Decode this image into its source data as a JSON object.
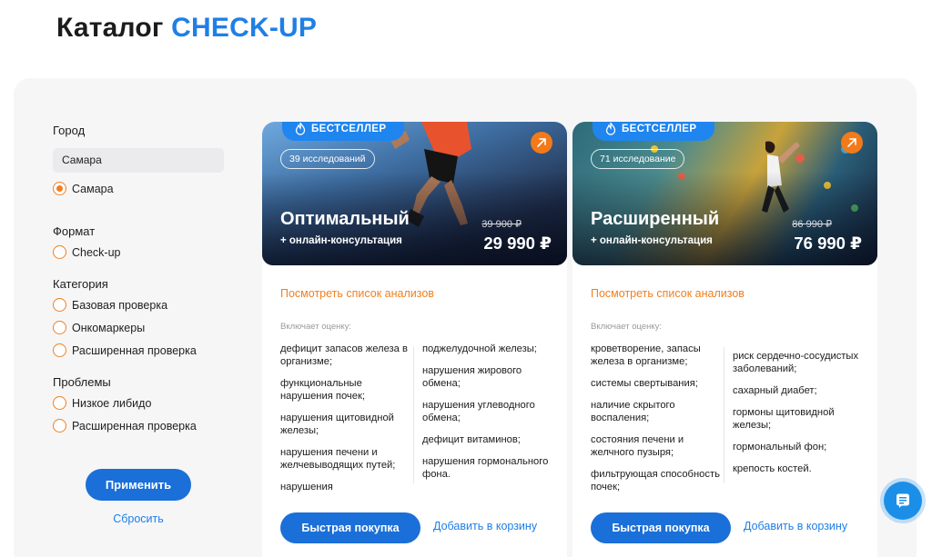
{
  "header": {
    "title_part1": "Каталог ",
    "title_part2": "CHECK-UP"
  },
  "filters": {
    "city": {
      "heading": "Город",
      "selected": "Самара",
      "options": [
        {
          "label": "Самара",
          "checked": true
        }
      ]
    },
    "format": {
      "heading": "Формат",
      "options": [
        {
          "label": "Check-up",
          "checked": false
        }
      ]
    },
    "category": {
      "heading": "Категория",
      "options": [
        {
          "label": "Базовая проверка",
          "checked": false
        },
        {
          "label": "Онкомаркеры",
          "checked": false
        },
        {
          "label": "Расширенная проверка",
          "checked": false
        }
      ]
    },
    "problems": {
      "heading": "Проблемы",
      "options": [
        {
          "label": "Низкое либидо",
          "checked": false
        },
        {
          "label": "Расширенная проверка",
          "checked": false
        }
      ]
    },
    "apply_label": "Применить",
    "reset_label": "Сбросить"
  },
  "cards": [
    {
      "badge": "БЕСТСЕЛЛЕР",
      "count": "39 исследований",
      "name": "Оптимальный",
      "subtitle": "+ онлайн-консультация",
      "old_price": "39 900 ₽",
      "price": "29 990 ₽",
      "list_link": "Посмотреть список анализов",
      "includes_label": "Включает оценку:",
      "col1": [
        "дефицит запасов железа в организме;",
        "функциональные нарушения почек;",
        "нарушения щитовидной железы;",
        "нарушения печени и желчевыводящих путей;",
        "нарушения"
      ],
      "col2": [
        "поджелудочной железы;",
        "нарушения жирового обмена;",
        "нарушения углеводного обмена;",
        "дефицит витаминов;",
        "нарушения гормонального фона."
      ],
      "buy_label": "Быстрая покупка",
      "cart_label": "Добавить в корзину"
    },
    {
      "badge": "БЕСТСЕЛЛЕР",
      "count": "71 исследование",
      "name": "Расширенный",
      "subtitle": "+ онлайн-консультация",
      "old_price": "86 990 ₽",
      "price": "76 990 ₽",
      "list_link": "Посмотреть список анализов",
      "includes_label": "Включает оценку:",
      "col1": [
        "кроветворение, запасы железа в организме;",
        "системы свертывания;",
        "наличие скрытого воспаления;",
        "состояния печени и желчного пузыря;",
        "фильтрующая способность почек;"
      ],
      "col2": [
        "риск сердечно-сосудистых заболеваний;",
        "сахарный диабет;",
        "гормоны щитовидной железы;",
        "гормональный фон;",
        "крепость костей."
      ],
      "buy_label": "Быстрая покупка",
      "cart_label": "Добавить в корзину"
    }
  ],
  "colors": {
    "accent_blue": "#1f7fe6",
    "button_blue": "#1b6fd8",
    "accent_orange": "#f07f20"
  },
  "icons": {
    "badge": "flame-icon",
    "card_link": "arrow-up-right-icon",
    "chat": "chat-icon"
  }
}
